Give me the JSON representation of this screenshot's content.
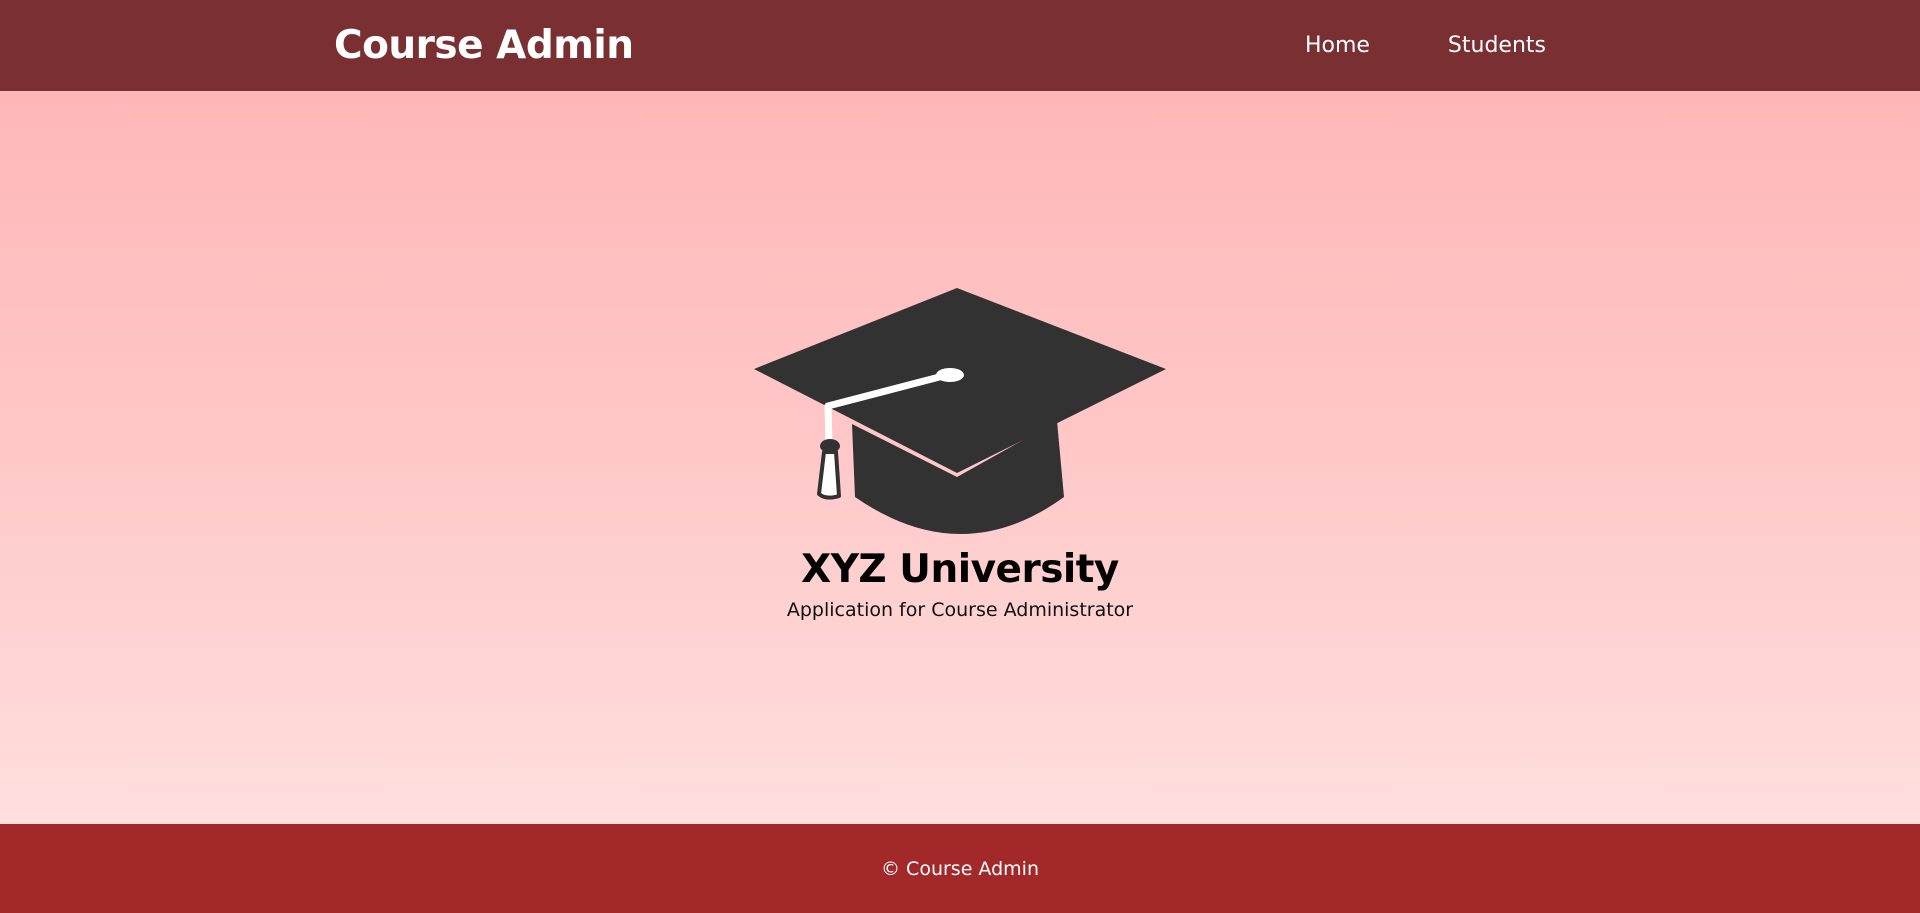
{
  "navbar": {
    "brand": "Course Admin",
    "links": [
      {
        "label": "Home"
      },
      {
        "label": "Students"
      }
    ],
    "background": "#7a3033"
  },
  "hero": {
    "logo_icon": "graduation-cap-icon",
    "title": "XYZ University",
    "subtitle": "Application for Course Administrator",
    "gradient_top": "#ffb6b7",
    "gradient_bottom": "#ffdedd"
  },
  "footer": {
    "text": "© Course Admin",
    "background": "#a3282a"
  }
}
